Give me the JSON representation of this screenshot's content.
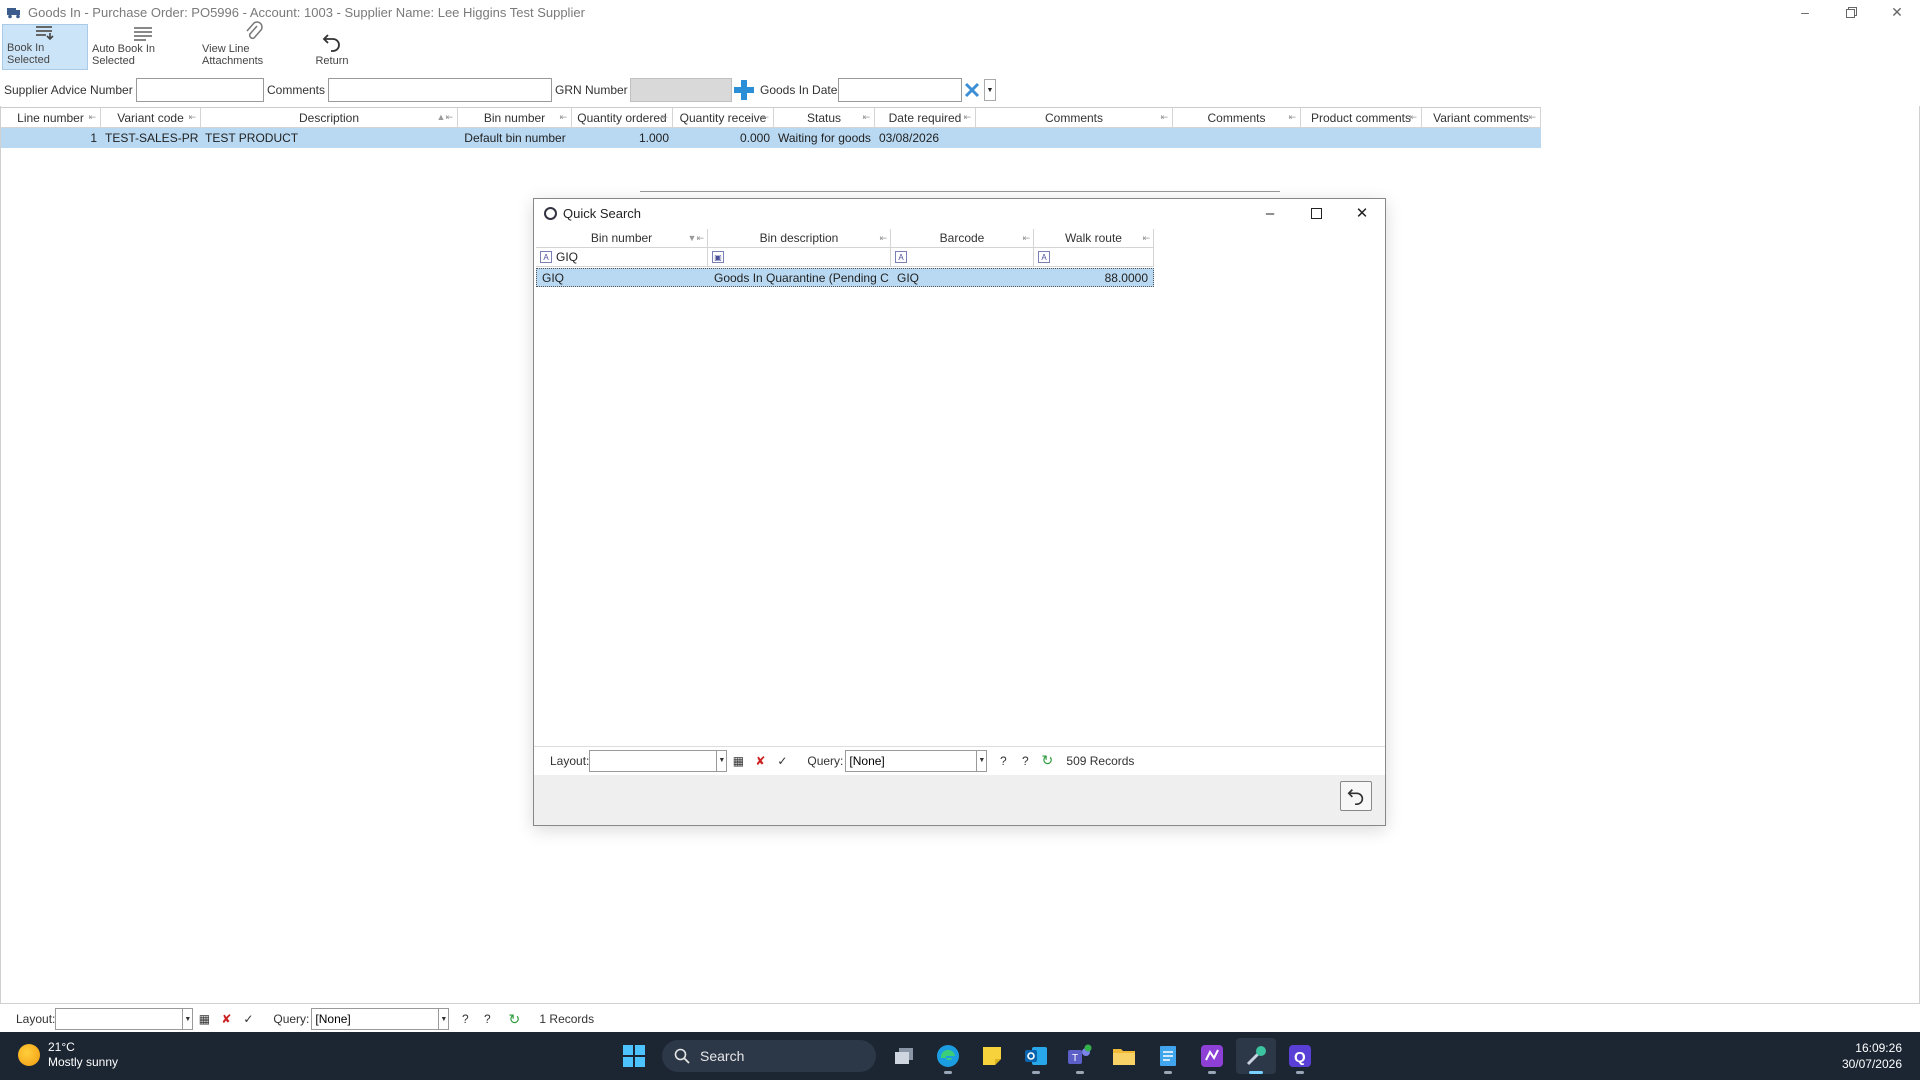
{
  "window": {
    "title": "Goods In - Purchase Order: PO5996 - Account: 1003 - Supplier Name: Lee Higgins Test Supplier"
  },
  "toolbar": {
    "book_in_selected": "Book In Selected",
    "auto_book_in_selected": "Auto Book In Selected",
    "view_line_attachments": "View Line Attachments",
    "return": "Return"
  },
  "header_fields": {
    "supplier_advice_label": "Supplier Advice Number",
    "supplier_advice_value": "",
    "comments_label": "Comments",
    "comments_value": "",
    "grn_label": "GRN Number",
    "grn_value": "",
    "goods_in_date_label": "Goods In Date",
    "goods_in_date_value": ""
  },
  "main_grid": {
    "columns": [
      "Line number",
      "Variant code",
      "Description",
      "Bin number",
      "Quantity ordered",
      "Quantity receive",
      "Status",
      "Date required",
      "Comments",
      "Comments",
      "Product comments",
      "Variant comments"
    ],
    "rows": [
      [
        "1",
        "TEST-SALES-PR",
        "TEST PRODUCT",
        "Default bin number",
        "1.000",
        "0.000",
        "Waiting for goods",
        "03/08/2026",
        "",
        "",
        "",
        ""
      ]
    ]
  },
  "quick_search": {
    "title": "Quick Search",
    "columns": [
      "Bin number",
      "Bin description",
      "Barcode",
      "Walk route"
    ],
    "filter_bin_number": "GIQ",
    "rows": [
      [
        "GIQ",
        "Goods In Quarantine (Pending C",
        "GIQ",
        "88.0000"
      ]
    ],
    "layout_label": "Layout:",
    "layout_value": "",
    "query_label": "Query:",
    "query_value": "[None]",
    "records": "509 Records"
  },
  "bottom_status": {
    "layout_label": "Layout:",
    "layout_value": "",
    "query_label": "Query:",
    "query_value": "[None]",
    "records": "1 Records"
  },
  "taskbar": {
    "temperature": "21°C",
    "weather": "Mostly sunny",
    "search_label": "Search",
    "time": "16:09:26",
    "date": "30/07/2026"
  },
  "colors": {
    "selection": "#b9d9f2",
    "taskbar": "#1c2633",
    "accent_blue": "#2a8fd6"
  }
}
